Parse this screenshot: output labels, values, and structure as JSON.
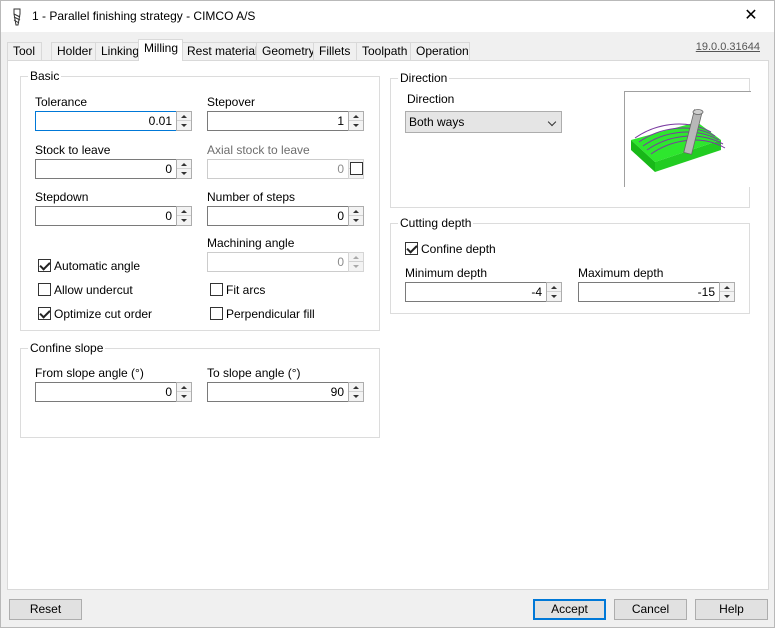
{
  "window": {
    "title": "1 - Parallel finishing strategy - CIMCO A/S",
    "close_glyph": "✕"
  },
  "tabs": [
    {
      "label": "Tool"
    },
    {
      "label": "Holder"
    },
    {
      "label": "Linking"
    },
    {
      "label": "Milling"
    },
    {
      "label": "Rest material"
    },
    {
      "label": "Geometry"
    },
    {
      "label": "Fillets"
    },
    {
      "label": "Toolpath"
    },
    {
      "label": "Operation"
    }
  ],
  "active_tab": "Milling",
  "version": "19.0.0.31644",
  "basic": {
    "title": "Basic",
    "tolerance": {
      "label": "Tolerance",
      "value": "0.01"
    },
    "stepover": {
      "label": "Stepover",
      "value": "1"
    },
    "stock_to_leave": {
      "label": "Stock to leave",
      "value": "0"
    },
    "axial_stock_to_leave": {
      "label": "Axial stock to leave",
      "value": "0"
    },
    "stepdown": {
      "label": "Stepdown",
      "value": "0"
    },
    "number_of_steps": {
      "label": "Number of steps",
      "value": "0"
    },
    "machining_angle": {
      "label": "Machining angle",
      "value": "0"
    },
    "automatic_angle": {
      "label": "Automatic angle",
      "checked": true
    },
    "allow_undercut": {
      "label": "Allow undercut",
      "checked": false
    },
    "fit_arcs": {
      "label": "Fit arcs",
      "checked": false
    },
    "optimize_cut_order": {
      "label": "Optimize cut order",
      "checked": true
    },
    "perpendicular_fill": {
      "label": "Perpendicular fill",
      "checked": false
    }
  },
  "confine_slope": {
    "title": "Confine slope",
    "from": {
      "label": "From slope angle (°)",
      "value": "0"
    },
    "to": {
      "label": "To slope angle (°)",
      "value": "90"
    }
  },
  "direction": {
    "title": "Direction",
    "label": "Direction",
    "selected": "Both ways"
  },
  "cutting_depth": {
    "title": "Cutting depth",
    "confine_depth": {
      "label": "Confine depth",
      "checked": true
    },
    "minimum": {
      "label": "Minimum depth",
      "value": "-4"
    },
    "maximum": {
      "label": "Maximum depth",
      "value": "-15"
    }
  },
  "buttons": {
    "reset": "Reset",
    "accept": "Accept",
    "cancel": "Cancel",
    "help": "Help"
  },
  "colors": {
    "accent": "#0078d7",
    "preview_green": "#22dd22"
  }
}
